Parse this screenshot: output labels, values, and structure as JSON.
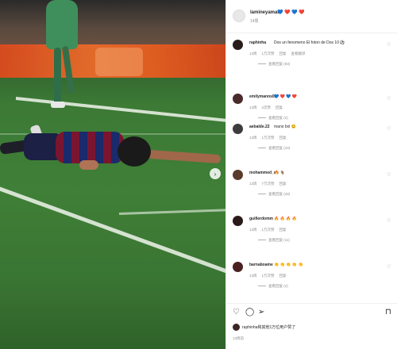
{
  "post": {
    "username": "lamineyamal",
    "hearts": "💙 ❤️ 💙 ❤️",
    "sub": "14周",
    "photo": {
      "alt_label": "",
      "next_icon": "chevron-right-icon"
    }
  },
  "comments": [
    {
      "user": "raphinha",
      "text": "Dos un fenomeno \nEl foton de Dos 10 ⚽",
      "meta": [
        "13周",
        "1万次赞",
        "回复",
        "查看翻译"
      ],
      "replies": "查看回复 (83)",
      "avatar_color": "#2b1c1c"
    },
    {
      "user": "emilymanns02",
      "text": "💙 ❤️ 💙 ❤️",
      "meta": [
        "13周",
        "2次赞",
        "回复"
      ],
      "replies": "查看回复 (2)",
      "avatar_color": "#4a2a2a"
    },
    {
      "user": "aebalde.22",
      "text": "mano bxl 😊",
      "meta": [
        "13周",
        "1万次赞",
        "回复"
      ],
      "replies": "查看回复 (10)",
      "avatar_color": "#3c3c3c"
    },
    {
      "user": "mohammed_au",
      "text": "🔥 🐐",
      "meta": [
        "13周",
        "7万次赞",
        "回复"
      ],
      "replies": "查看回复 (28)",
      "avatar_color": "#5a3a2a"
    },
    {
      "user": "guillerdomm",
      "text": "🔥 🔥 🔥 🔥",
      "meta": [
        "13周",
        "1万次赞",
        "回复"
      ],
      "replies": "查看回复 (11)",
      "avatar_color": "#2a1a1a"
    },
    {
      "user": "barnaboame",
      "text": "👏 👏 👏 👏 👏",
      "meta": [
        "13周",
        "1万次赞",
        "回复"
      ],
      "replies": "查看回复 (2)",
      "avatar_color": "#4a2020"
    }
  ],
  "actions": {
    "like_icon": "heart-icon",
    "comment_icon": "comment-icon",
    "share_icon": "share-icon",
    "save_icon": "bookmark-icon"
  },
  "bottom": {
    "text": "raphinha和其他1万位用户赞了",
    "date": "13周前"
  }
}
